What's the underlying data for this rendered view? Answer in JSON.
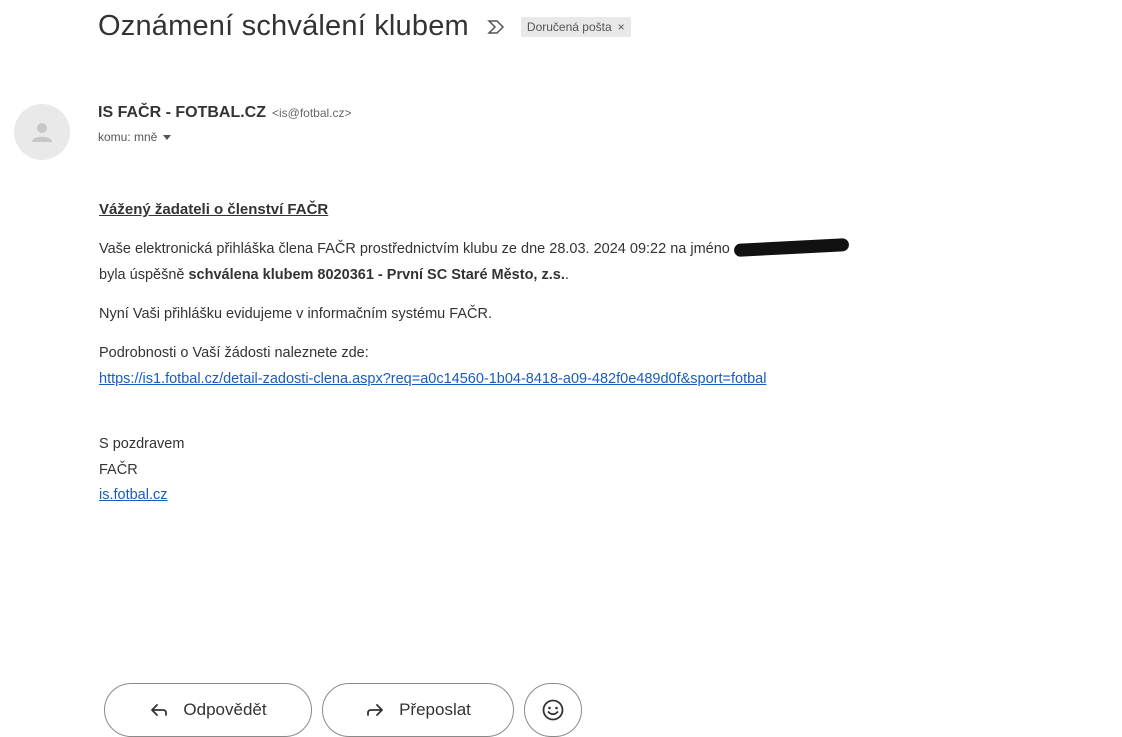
{
  "email": {
    "subject": "Oznámení schválení klubem",
    "label_chip": "Doručená pošta",
    "label_close": "×",
    "sender_name": "IS FAČR - FOTBAL.CZ",
    "sender_email": "<is@fotbal.cz>",
    "recipient": "komu: mně"
  },
  "body": {
    "greeting": "Vážený žadateli o členství FAČR",
    "p1_start": "Vaše elektronická přihláška člena FAČR prostřednictvím klubu ze dne 28.03. 2024 09:22 na jméno",
    "p1_line2_start": "byla úspěšně ",
    "p1_bold": "schválena klubem 8020361 - První SC Staré Město, z.s.",
    "p1_end": ".",
    "p2": "Nyní Vaši přihlášku evidujeme v informačním systému FAČR.",
    "p3": "Podrobnosti o Vaší žádosti naleznete zde:",
    "detail_link": "https://is1.fotbal.cz/detail-zadosti-clena.aspx?req=a0c14560-1b04-8418-a09-482f0e489d0f&sport=fotbal",
    "closing": "S pozdravem",
    "org": "FAČR",
    "site_link": "is.fotbal.cz"
  },
  "actions": {
    "reply": "Odpovědět",
    "forward": "Přeposlat"
  }
}
